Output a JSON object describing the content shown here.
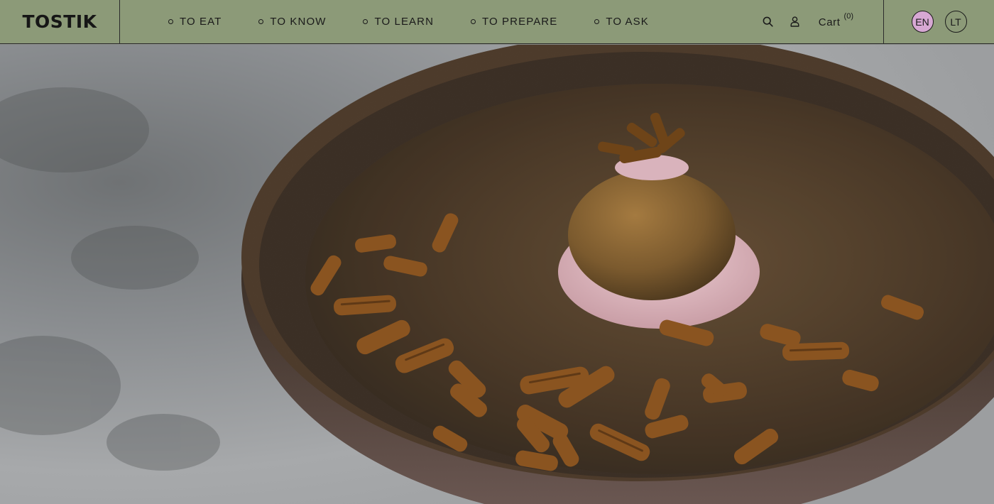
{
  "header": {
    "logo": "TOSTIK",
    "nav": [
      {
        "label": "TO EAT"
      },
      {
        "label": "TO KNOW"
      },
      {
        "label": "TO LEARN"
      },
      {
        "label": "TO PREPARE"
      },
      {
        "label": "TO ASK"
      }
    ],
    "search_icon": "search-icon",
    "user_icon": "user-icon",
    "cart_label": "Cart",
    "cart_count": "(0)",
    "languages": [
      {
        "code": "EN",
        "active": true
      },
      {
        "code": "LT",
        "active": false
      }
    ]
  },
  "hero": {
    "image": "Fried ball on pink sauce with fried insects on a dark ceramic plate",
    "colors": {
      "header_bg": "#8c9a78",
      "active_lang": "#d7a8d3",
      "sauce": "#d9b3bc",
      "plate": "#4a3a2a"
    }
  }
}
